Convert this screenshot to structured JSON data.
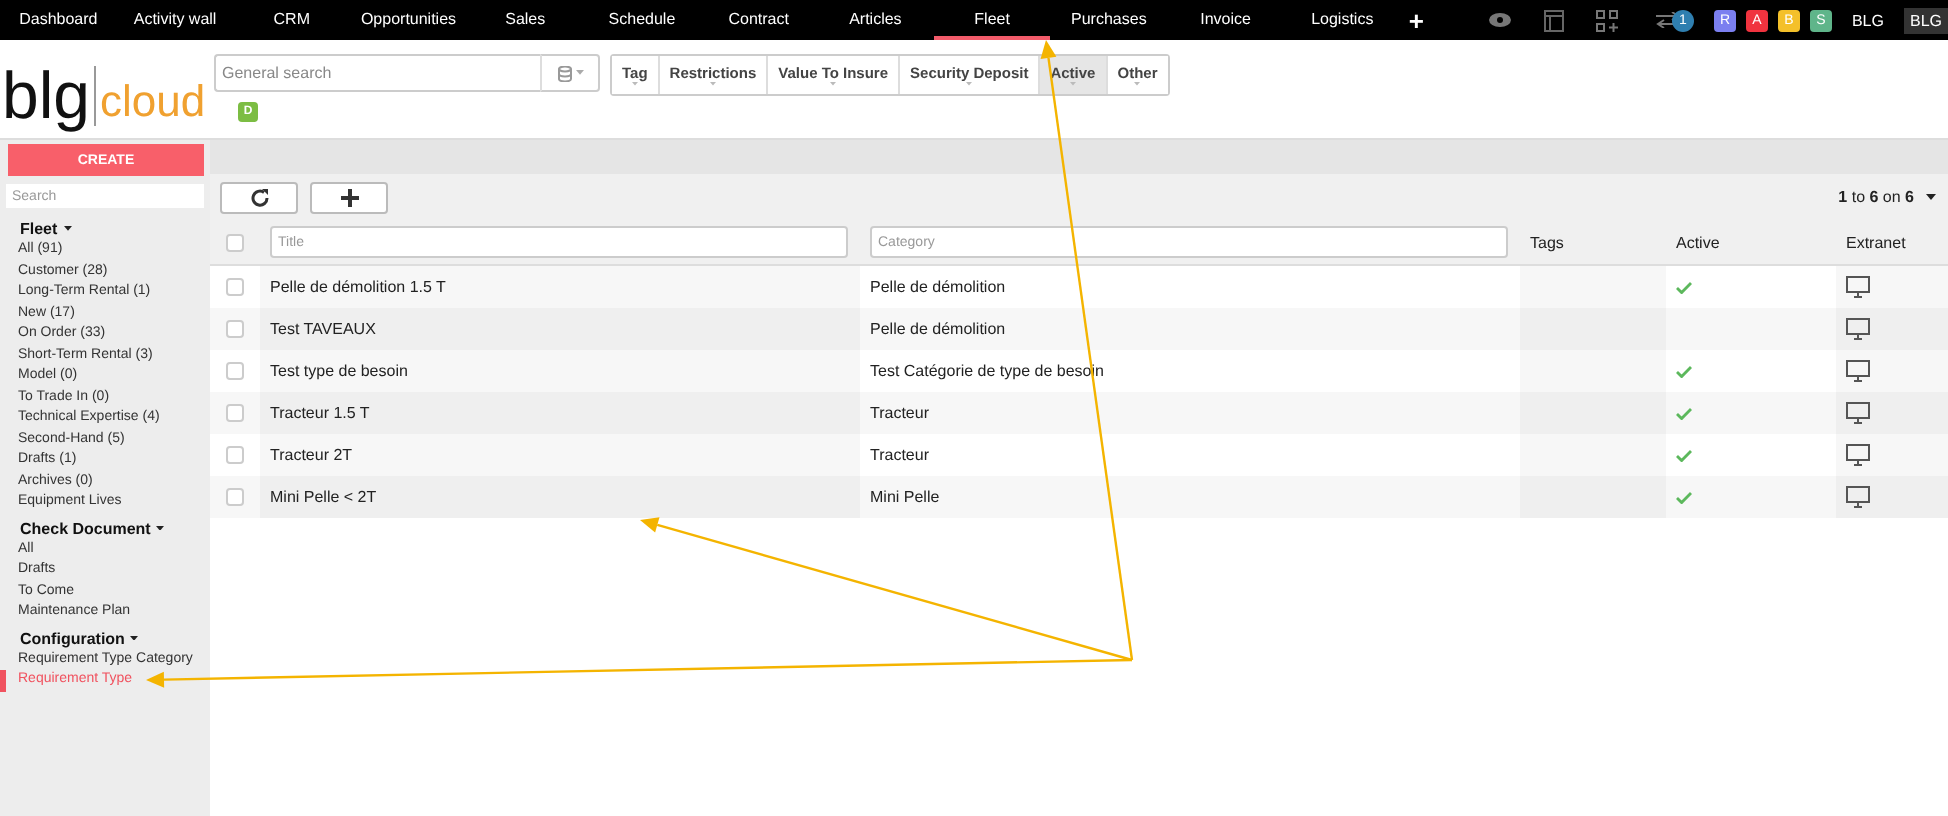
{
  "nav": {
    "items": [
      {
        "label": "Dashboard",
        "selected": false
      },
      {
        "label": "Activity wall",
        "selected": false
      },
      {
        "label": "CRM",
        "selected": false
      },
      {
        "label": "Opportunities",
        "selected": false
      },
      {
        "label": "Sales",
        "selected": false
      },
      {
        "label": "Schedule",
        "selected": false
      },
      {
        "label": "Contract",
        "selected": false
      },
      {
        "label": "Articles",
        "selected": false
      },
      {
        "label": "Fleet",
        "selected": true
      },
      {
        "label": "Purchases",
        "selected": false
      },
      {
        "label": "Invoice",
        "selected": false
      },
      {
        "label": "Logistics",
        "selected": false
      }
    ],
    "add": "+",
    "notification_count": "1",
    "user_badges": [
      {
        "label": "R",
        "color": "#7b7ff0"
      },
      {
        "label": "A",
        "color": "#f0333f"
      },
      {
        "label": "B",
        "color": "#f4c02a"
      },
      {
        "label": "S",
        "color": "#5fb58a"
      }
    ],
    "company": "BLG",
    "company_box": "BLG"
  },
  "logo": {
    "left": "blg",
    "right": "cloud"
  },
  "search": {
    "placeholder": "General search",
    "tag": "D"
  },
  "filters": [
    {
      "label": "Tag",
      "selected": false
    },
    {
      "label": "Restrictions",
      "selected": false
    },
    {
      "label": "Value To Insure",
      "selected": false
    },
    {
      "label": "Security Deposit",
      "selected": false
    },
    {
      "label": "Active",
      "selected": true
    },
    {
      "label": "Other",
      "selected": false
    }
  ],
  "sidebar": {
    "create": "CREATE",
    "search_placeholder": "Search",
    "sections": [
      {
        "title": "Fleet",
        "items": [
          {
            "label": "All (91)",
            "selected": false
          },
          {
            "label": "Customer (28)",
            "selected": false
          },
          {
            "label": "Long-Term Rental (1)",
            "selected": false
          },
          {
            "label": "New (17)",
            "selected": false
          },
          {
            "label": "On Order (33)",
            "selected": false
          },
          {
            "label": "Short-Term Rental (3)",
            "selected": false
          },
          {
            "label": "Model (0)",
            "selected": false
          },
          {
            "label": "To Trade In (0)",
            "selected": false
          },
          {
            "label": "Technical Expertise (4)",
            "selected": false
          },
          {
            "label": "Second-Hand (5)",
            "selected": false
          },
          {
            "label": "Drafts (1)",
            "selected": false
          },
          {
            "label": "Archives (0)",
            "selected": false
          },
          {
            "label": "Equipment Lives",
            "selected": false
          }
        ]
      },
      {
        "title": "Check Document",
        "items": [
          {
            "label": "All",
            "selected": false
          },
          {
            "label": "Drafts",
            "selected": false
          },
          {
            "label": "To Come",
            "selected": false
          },
          {
            "label": "Maintenance Plan",
            "selected": false
          }
        ]
      },
      {
        "title": "Configuration",
        "items": [
          {
            "label": "Requirement Type Category",
            "selected": false
          },
          {
            "label": "Requirement Type",
            "selected": true
          }
        ]
      }
    ]
  },
  "pagination": "**1** to **6** on **6**",
  "table": {
    "select_all_checked": false,
    "columns": {
      "title_placeholder": "Title",
      "category_placeholder": "Category",
      "tags": "Tags",
      "active": "Active",
      "extranet": "Extranet"
    },
    "rows": [
      {
        "title": "Pelle de démolition 1.5 T",
        "category": "Pelle de démolition",
        "checked": false,
        "active": true
      },
      {
        "title": "Test TAVEAUX",
        "category": "Pelle de démolition",
        "checked": false,
        "active": false
      },
      {
        "title": "Test type de besoin",
        "category": "Test Catégorie de type de besoin",
        "checked": false,
        "active": true
      },
      {
        "title": "Tracteur 1.5 T",
        "category": "Tracteur",
        "checked": false,
        "active": true
      },
      {
        "title": "Tracteur 2T",
        "category": "Tracteur",
        "checked": false,
        "active": true
      },
      {
        "title": "Mini Pelle < 2T",
        "category": "Mini Pelle",
        "checked": false,
        "active": true
      }
    ]
  }
}
